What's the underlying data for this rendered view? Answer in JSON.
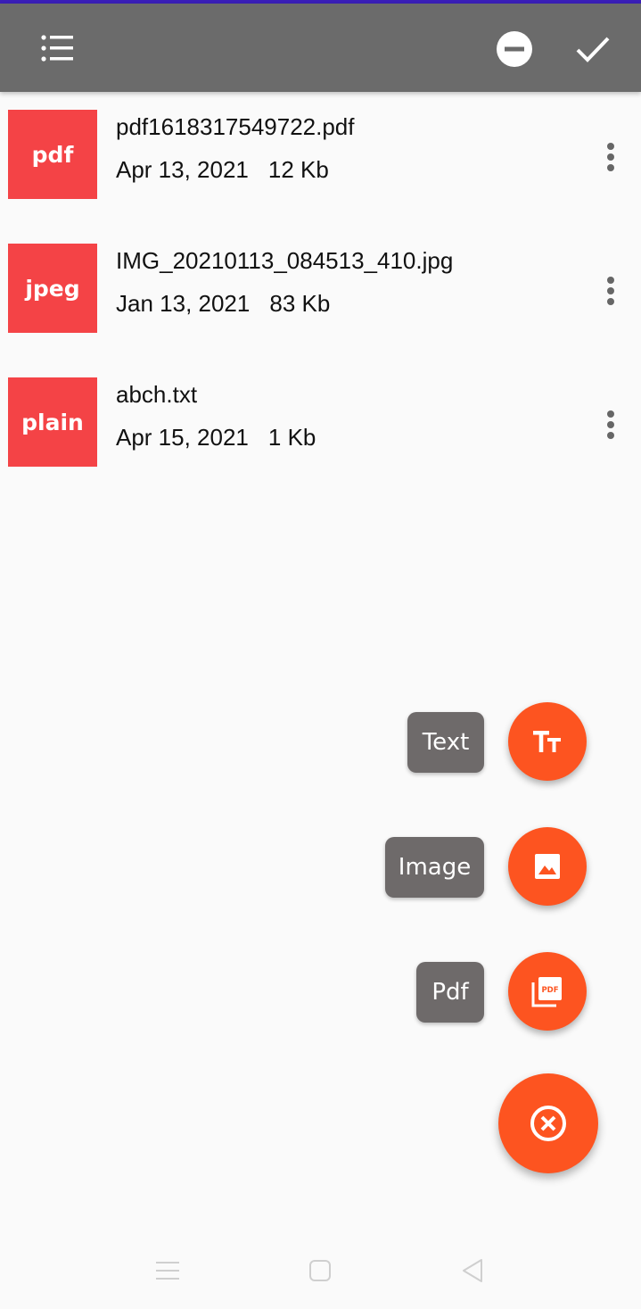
{
  "toolbar": {
    "menu_icon": "list-icon",
    "deselect_icon": "minus-circle-icon",
    "confirm_icon": "check-icon"
  },
  "files": [
    {
      "type": "pdf",
      "name": "pdf1618317549722.pdf",
      "date": "Apr 13, 2021",
      "size": "12 Kb"
    },
    {
      "type": "jpeg",
      "name": "IMG_20210113_084513_410.jpg",
      "date": "Jan 13, 2021",
      "size": "83 Kb"
    },
    {
      "type": "plain",
      "name": "abch.txt",
      "date": "Apr 15, 2021",
      "size": "1 Kb"
    }
  ],
  "fab_menu": {
    "text_label": "Text",
    "image_label": "Image",
    "pdf_label": "Pdf",
    "text_icon": "text-format-icon",
    "image_icon": "image-icon",
    "pdf_icon": "picture-as-pdf-icon",
    "close_icon": "close-circle-icon"
  },
  "colors": {
    "toolbar": "#6b6b6b",
    "thumb": "#f44346",
    "fab": "#fd5420",
    "label_bg": "#6e6a6a"
  }
}
